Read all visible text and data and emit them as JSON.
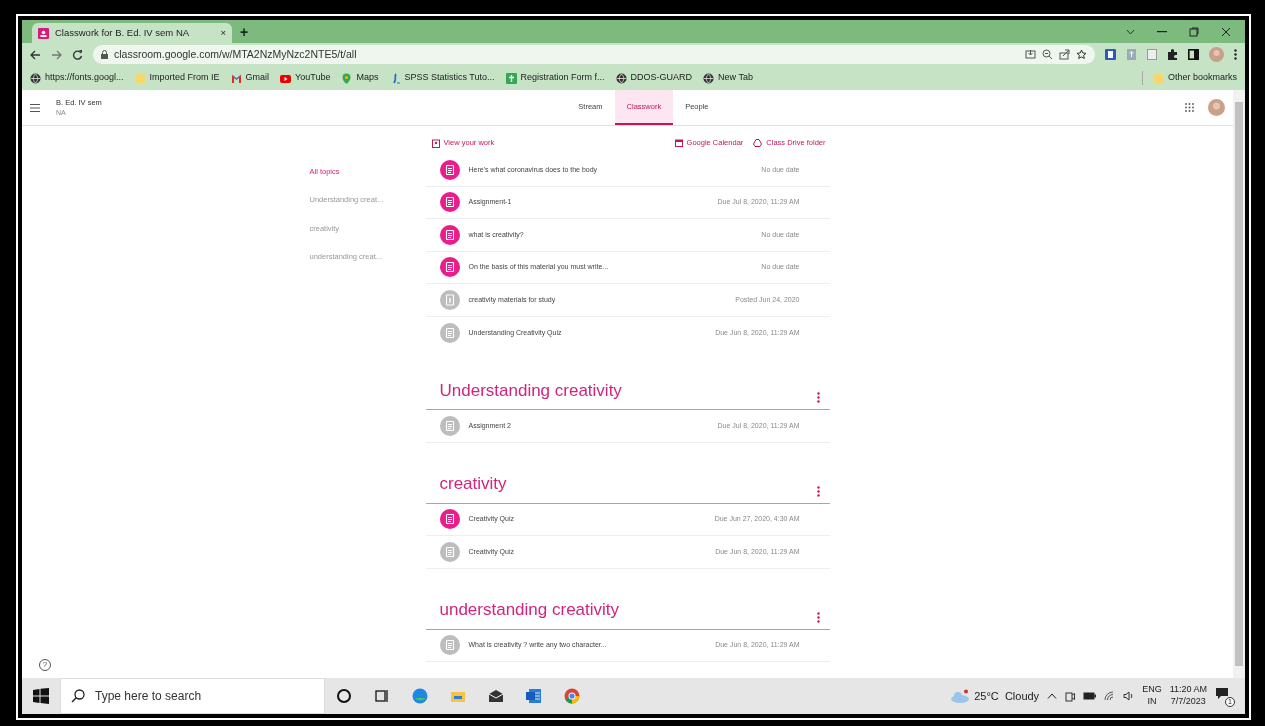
{
  "browser": {
    "tab": {
      "title": "Classwork for B. Ed. IV sem NA",
      "close": "×",
      "new_tab": "+"
    },
    "address": "classroom.google.com/w/MTA2NzMyNzc2NTE5/t/all",
    "bookmarks": [
      {
        "label": "https://fonts.googl...",
        "kind": "globe"
      },
      {
        "label": "Imported From IE",
        "kind": "folder"
      },
      {
        "label": "Gmail",
        "kind": "gmail"
      },
      {
        "label": "YouTube",
        "kind": "youtube"
      },
      {
        "label": "Maps",
        "kind": "maps"
      },
      {
        "label": "SPSS Statistics Tuto...",
        "kind": "spss"
      },
      {
        "label": "Registration Form f...",
        "kind": "forms"
      },
      {
        "label": "DDOS-GUARD",
        "kind": "globe"
      },
      {
        "label": "New Tab",
        "kind": "globe"
      }
    ],
    "other_bookmarks": "Other bookmarks"
  },
  "classroom": {
    "class_name": "B. Ed. IV sem",
    "section": "NA",
    "tabs": [
      {
        "label": "Stream",
        "selected": false
      },
      {
        "label": "Classwork",
        "selected": true
      },
      {
        "label": "People",
        "selected": false
      }
    ],
    "links": {
      "view_work": "View your work",
      "calendar": "Google Calendar",
      "drive": "Class Drive folder"
    },
    "topics": [
      {
        "label": "All topics",
        "selected": true
      },
      {
        "label": "Understanding creat...",
        "selected": false
      },
      {
        "label": "creativity",
        "selected": false
      },
      {
        "label": "understanding creat...",
        "selected": false
      }
    ],
    "sections": [
      {
        "items": [
          {
            "title": "Here's what coronavirus does to the body",
            "date": "No due date",
            "kind": "assignment",
            "pending": true
          },
          {
            "title": "Assignment-1",
            "date": "Due Jul 8, 2020, 11:29 AM",
            "kind": "assignment",
            "pending": true
          },
          {
            "title": "what is creativity?",
            "date": "No due date",
            "kind": "assignment",
            "pending": true
          },
          {
            "title": "On the basis of this material you must write...",
            "date": "No due date",
            "kind": "assignment",
            "pending": true
          },
          {
            "title": "creativity materials for study",
            "date": "Posted Jun 24, 2020",
            "kind": "material",
            "pending": false
          },
          {
            "title": "Understanding Creativity Quiz",
            "date": "Due Jun 8, 2020, 11:29 AM",
            "kind": "assignment",
            "pending": false
          }
        ]
      },
      {
        "topic": "Understanding creativity",
        "items": [
          {
            "title": "Assignment 2",
            "date": "Due Jul 8, 2020, 11:29 AM",
            "kind": "assignment",
            "pending": false
          }
        ]
      },
      {
        "topic": "creativity",
        "items": [
          {
            "title": "Creativity Quiz",
            "date": "Due Jun 27, 2020, 4:30 AM",
            "kind": "assignment",
            "pending": true
          },
          {
            "title": "Creativity Quiz",
            "date": "Due Jun 8, 2020, 11:29 AM",
            "kind": "assignment",
            "pending": false
          }
        ]
      },
      {
        "topic": "understanding creativity",
        "items": [
          {
            "title": "What is creativity ? write any two character...",
            "date": "Due Jun 8, 2020, 11:29 AM",
            "kind": "assignment",
            "pending": false
          }
        ]
      }
    ]
  },
  "help": "?",
  "taskbar": {
    "search_placeholder": "Type here to search",
    "weather": "25°C  Cloudy",
    "language": "ENG",
    "region": "IN",
    "time": "11:20 AM",
    "date": "7/7/2023",
    "notifications": "1"
  }
}
